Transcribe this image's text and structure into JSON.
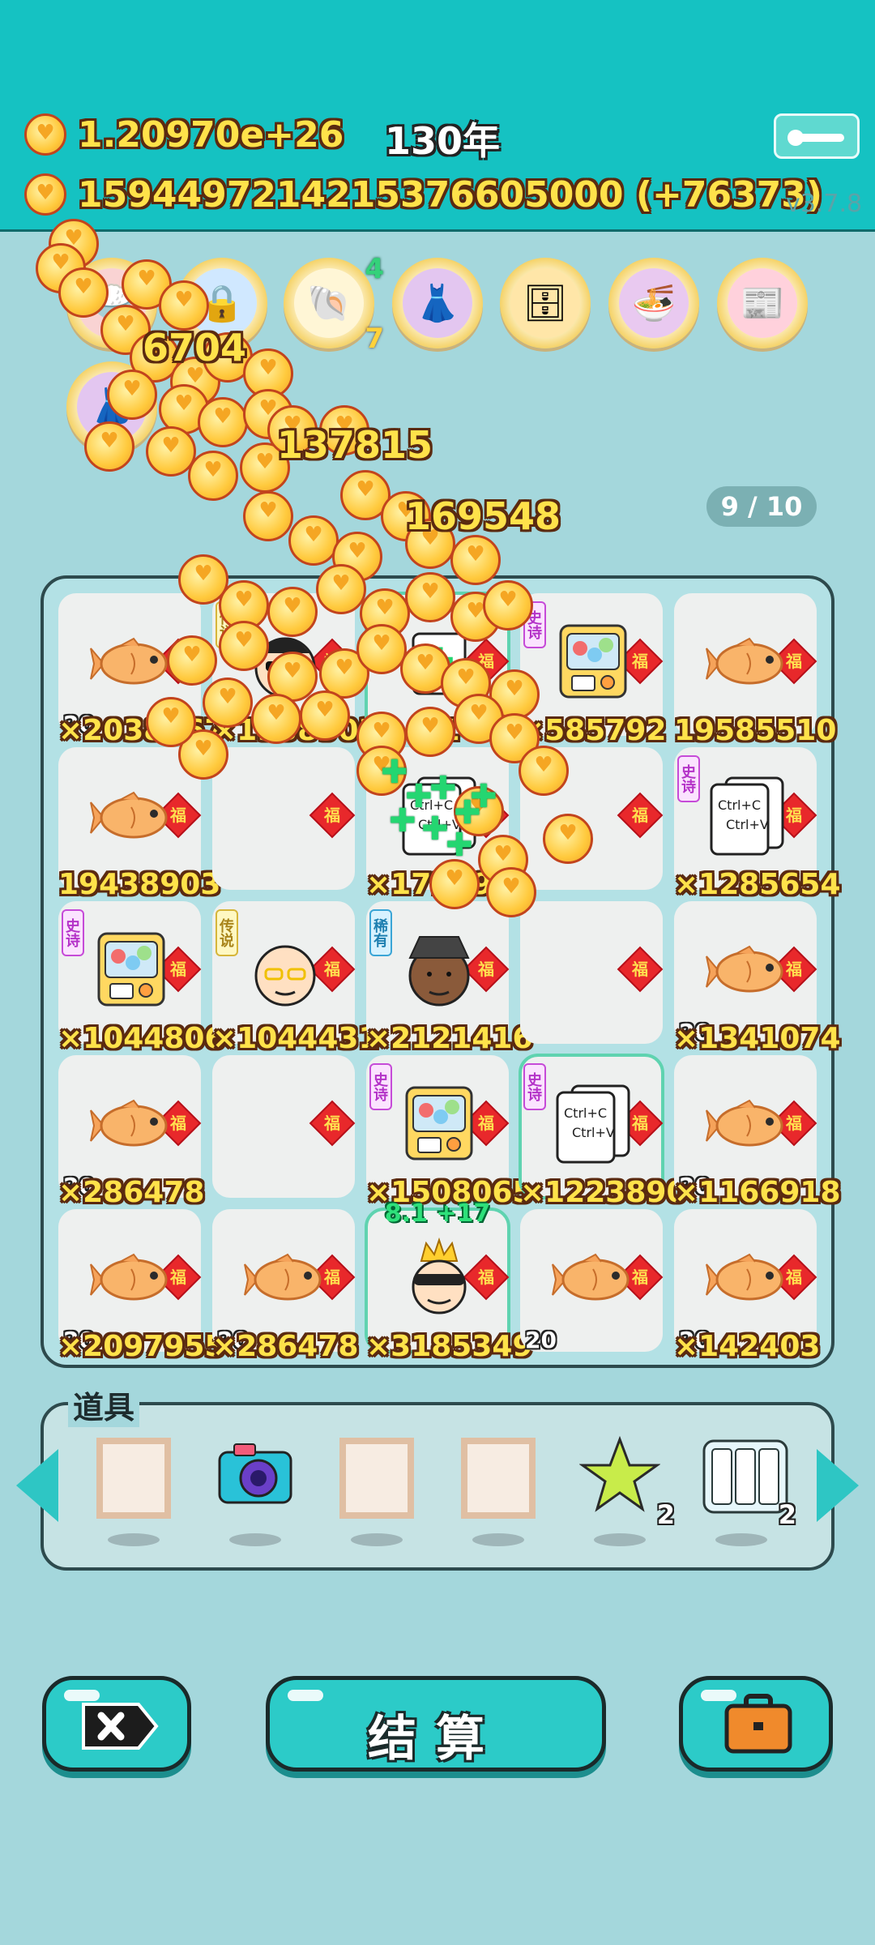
{
  "header": {
    "money_total": "1.20970e+26",
    "year": "130年",
    "money_detail": "1594497214215376605000 (+76373)",
    "version": "v3.7.8"
  },
  "artifacts": [
    {
      "name": "rice-bowl-icon"
    },
    {
      "name": "blue-safe-icon"
    },
    {
      "name": "shell-icon",
      "top_count": "4",
      "bottom_count": "7"
    },
    {
      "name": "skirt-icon"
    },
    {
      "name": "safe-icon"
    },
    {
      "name": "bowls-arrow-icon"
    },
    {
      "name": "time-magazine-icon"
    }
  ],
  "page_indicator": "9 / 10",
  "board": {
    "cells": [
      {
        "type": "fish",
        "mult": "×2038967",
        "small": "20"
      },
      {
        "type": "man-sunglasses",
        "rarity": "传说",
        "mult": "×1938903"
      },
      {
        "type": "clover",
        "mult": "×1",
        "top": "4"
      },
      {
        "type": "capsule-machine",
        "rarity": "史诗",
        "mult": "×585792"
      },
      {
        "type": "fish",
        "mult": "19585510"
      },
      {
        "type": "fish",
        "mult": "19438903"
      },
      {
        "type": "empty",
        "mult": ""
      },
      {
        "type": "ctrl-cv",
        "mult": "×1723990"
      },
      {
        "type": "empty",
        "mult": ""
      },
      {
        "type": "ctrl-cv",
        "rarity": "史诗",
        "mult": "×1285654"
      },
      {
        "type": "capsule-machine",
        "rarity": "史诗",
        "mult": "×1044806"
      },
      {
        "type": "old-man",
        "rarity": "传说",
        "mult": "×1044431"
      },
      {
        "type": "bucket-hat-man",
        "rarity": "稀有",
        "mult": "×2121416"
      },
      {
        "type": "empty",
        "mult": ""
      },
      {
        "type": "fish",
        "mult": "×1341074",
        "small": "20"
      },
      {
        "type": "fish",
        "mult": "×286478",
        "small": "20"
      },
      {
        "type": "empty",
        "mult": ""
      },
      {
        "type": "capsule-machine",
        "rarity": "史诗",
        "mult": "×1508065"
      },
      {
        "type": "ctrl-cv",
        "rarity": "史诗",
        "mult": "×1223890"
      },
      {
        "type": "fish",
        "mult": "×1166918",
        "small": "20"
      },
      {
        "type": "fish",
        "mult": "×2097955",
        "small": "20"
      },
      {
        "type": "fish",
        "mult": "×286478",
        "small": "20"
      },
      {
        "type": "thief-crown",
        "mult": "×3185349",
        "top": "8.1 +17"
      },
      {
        "type": "fish",
        "mult": "",
        "small": "20"
      },
      {
        "type": "fish",
        "mult": "×142403",
        "small": "20"
      }
    ],
    "ctrl_text": {
      "c": "Ctrl+C",
      "v": "Ctrl+V"
    },
    "fu": "福"
  },
  "effects": {
    "numbers": [
      "6704",
      "137815",
      "169548"
    ]
  },
  "tools": {
    "title": "道具",
    "items": [
      {
        "name": "blank-frame-icon"
      },
      {
        "name": "camera-icon"
      },
      {
        "name": "blank-frame-icon"
      },
      {
        "name": "blank-frame-icon"
      },
      {
        "name": "star-icon",
        "count": "2"
      },
      {
        "name": "triple-frame-icon",
        "count": "2"
      }
    ]
  },
  "buttons": {
    "settle_label": "结算"
  },
  "colors": {
    "accent": "#15c2c2",
    "background": "#a4d7dc",
    "gold": "#ffe24a",
    "fu_red": "#e8282b"
  }
}
